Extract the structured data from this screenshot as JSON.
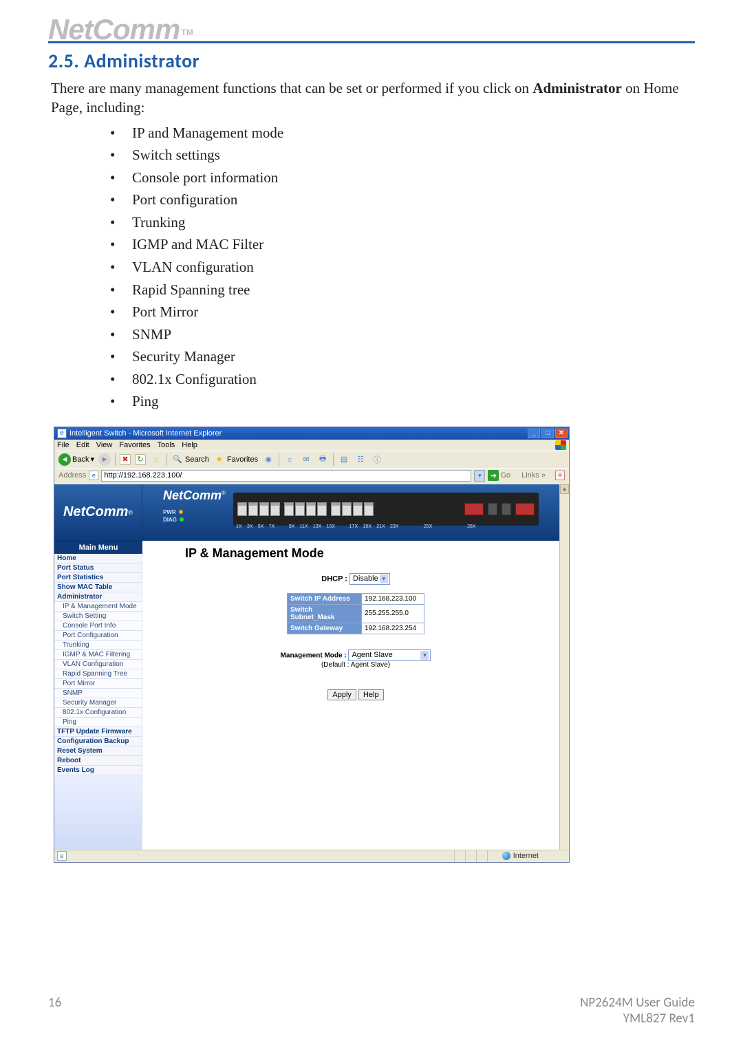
{
  "logo": "NetComm",
  "tm": "TM",
  "section_title": "2.5. Administrator",
  "intro": {
    "pre": "There are many management functions that can be set or performed if you click on ",
    "strong": "Administrator",
    "post": " on Home Page, including:"
  },
  "bullets": [
    "IP and Management mode",
    "Switch settings",
    "Console port information",
    "Port configuration",
    "Trunking",
    "IGMP and MAC Filter",
    "VLAN configuration",
    "Rapid Spanning tree",
    "Port Mirror",
    "SNMP",
    "Security Manager",
    "802.1x Configuration",
    "Ping"
  ],
  "browser": {
    "title": "Intelligent Switch - Microsoft Internet Explorer",
    "menus": [
      "File",
      "Edit",
      "View",
      "Favorites",
      "Tools",
      "Help"
    ],
    "toolbar": {
      "back": "Back",
      "search": "Search",
      "favorites": "Favorites"
    },
    "address_label": "Address",
    "url": "http://192.168.223.100/",
    "go": "Go",
    "links": "Links",
    "status_zone": "Internet"
  },
  "switch_ui": {
    "brand": "NetComm",
    "reg": "®",
    "main_menu": "Main Menu",
    "menu": [
      "Home",
      "Port Status",
      "Port Statistics",
      "Show MAC Table",
      "Administrator",
      "TFTP Update Firmware",
      "Configuration Backup",
      "Reset System",
      "Reboot",
      "Events Log"
    ],
    "admin_sub": [
      "IP & Management Mode",
      "Switch Setting",
      "Console Port Info",
      "Port Configuration",
      "Trunking",
      "IGMP & MAC Filtering",
      "VLAN Configuration",
      "Rapid Spanning Tree",
      "Port Mirror",
      "SNMP",
      "Security Manager",
      "802.1x Configuration",
      "Ping"
    ],
    "leds": {
      "pwr": "PWR",
      "diag": "DIAG"
    },
    "port_labels": [
      "1X",
      "3X",
      "5X",
      "7X",
      "9X",
      "11X",
      "13X",
      "15X",
      "17X",
      "19X",
      "21X",
      "23X",
      "25X",
      "26X"
    ],
    "page_title": "IP & Management Mode",
    "dhcp_label": "DHCP :",
    "dhcp_value": "Disable",
    "fields": {
      "ip_label": "Switch IP Address",
      "ip_value": "192.168.223.100",
      "mask_label": "Switch Subnet_Mask",
      "mask_value": "255.255.255.0",
      "gw_label": "Switch Gateway",
      "gw_value": "192.168.223.254"
    },
    "mm_label": "Management Mode :",
    "mm_value": "Agent Slave",
    "mm_default": "(Default : Agent Slave)",
    "apply": "Apply",
    "help": "Help"
  },
  "footer": {
    "page": "16",
    "guide": "NP2624M User Guide",
    "rev": "YML827 Rev1"
  }
}
